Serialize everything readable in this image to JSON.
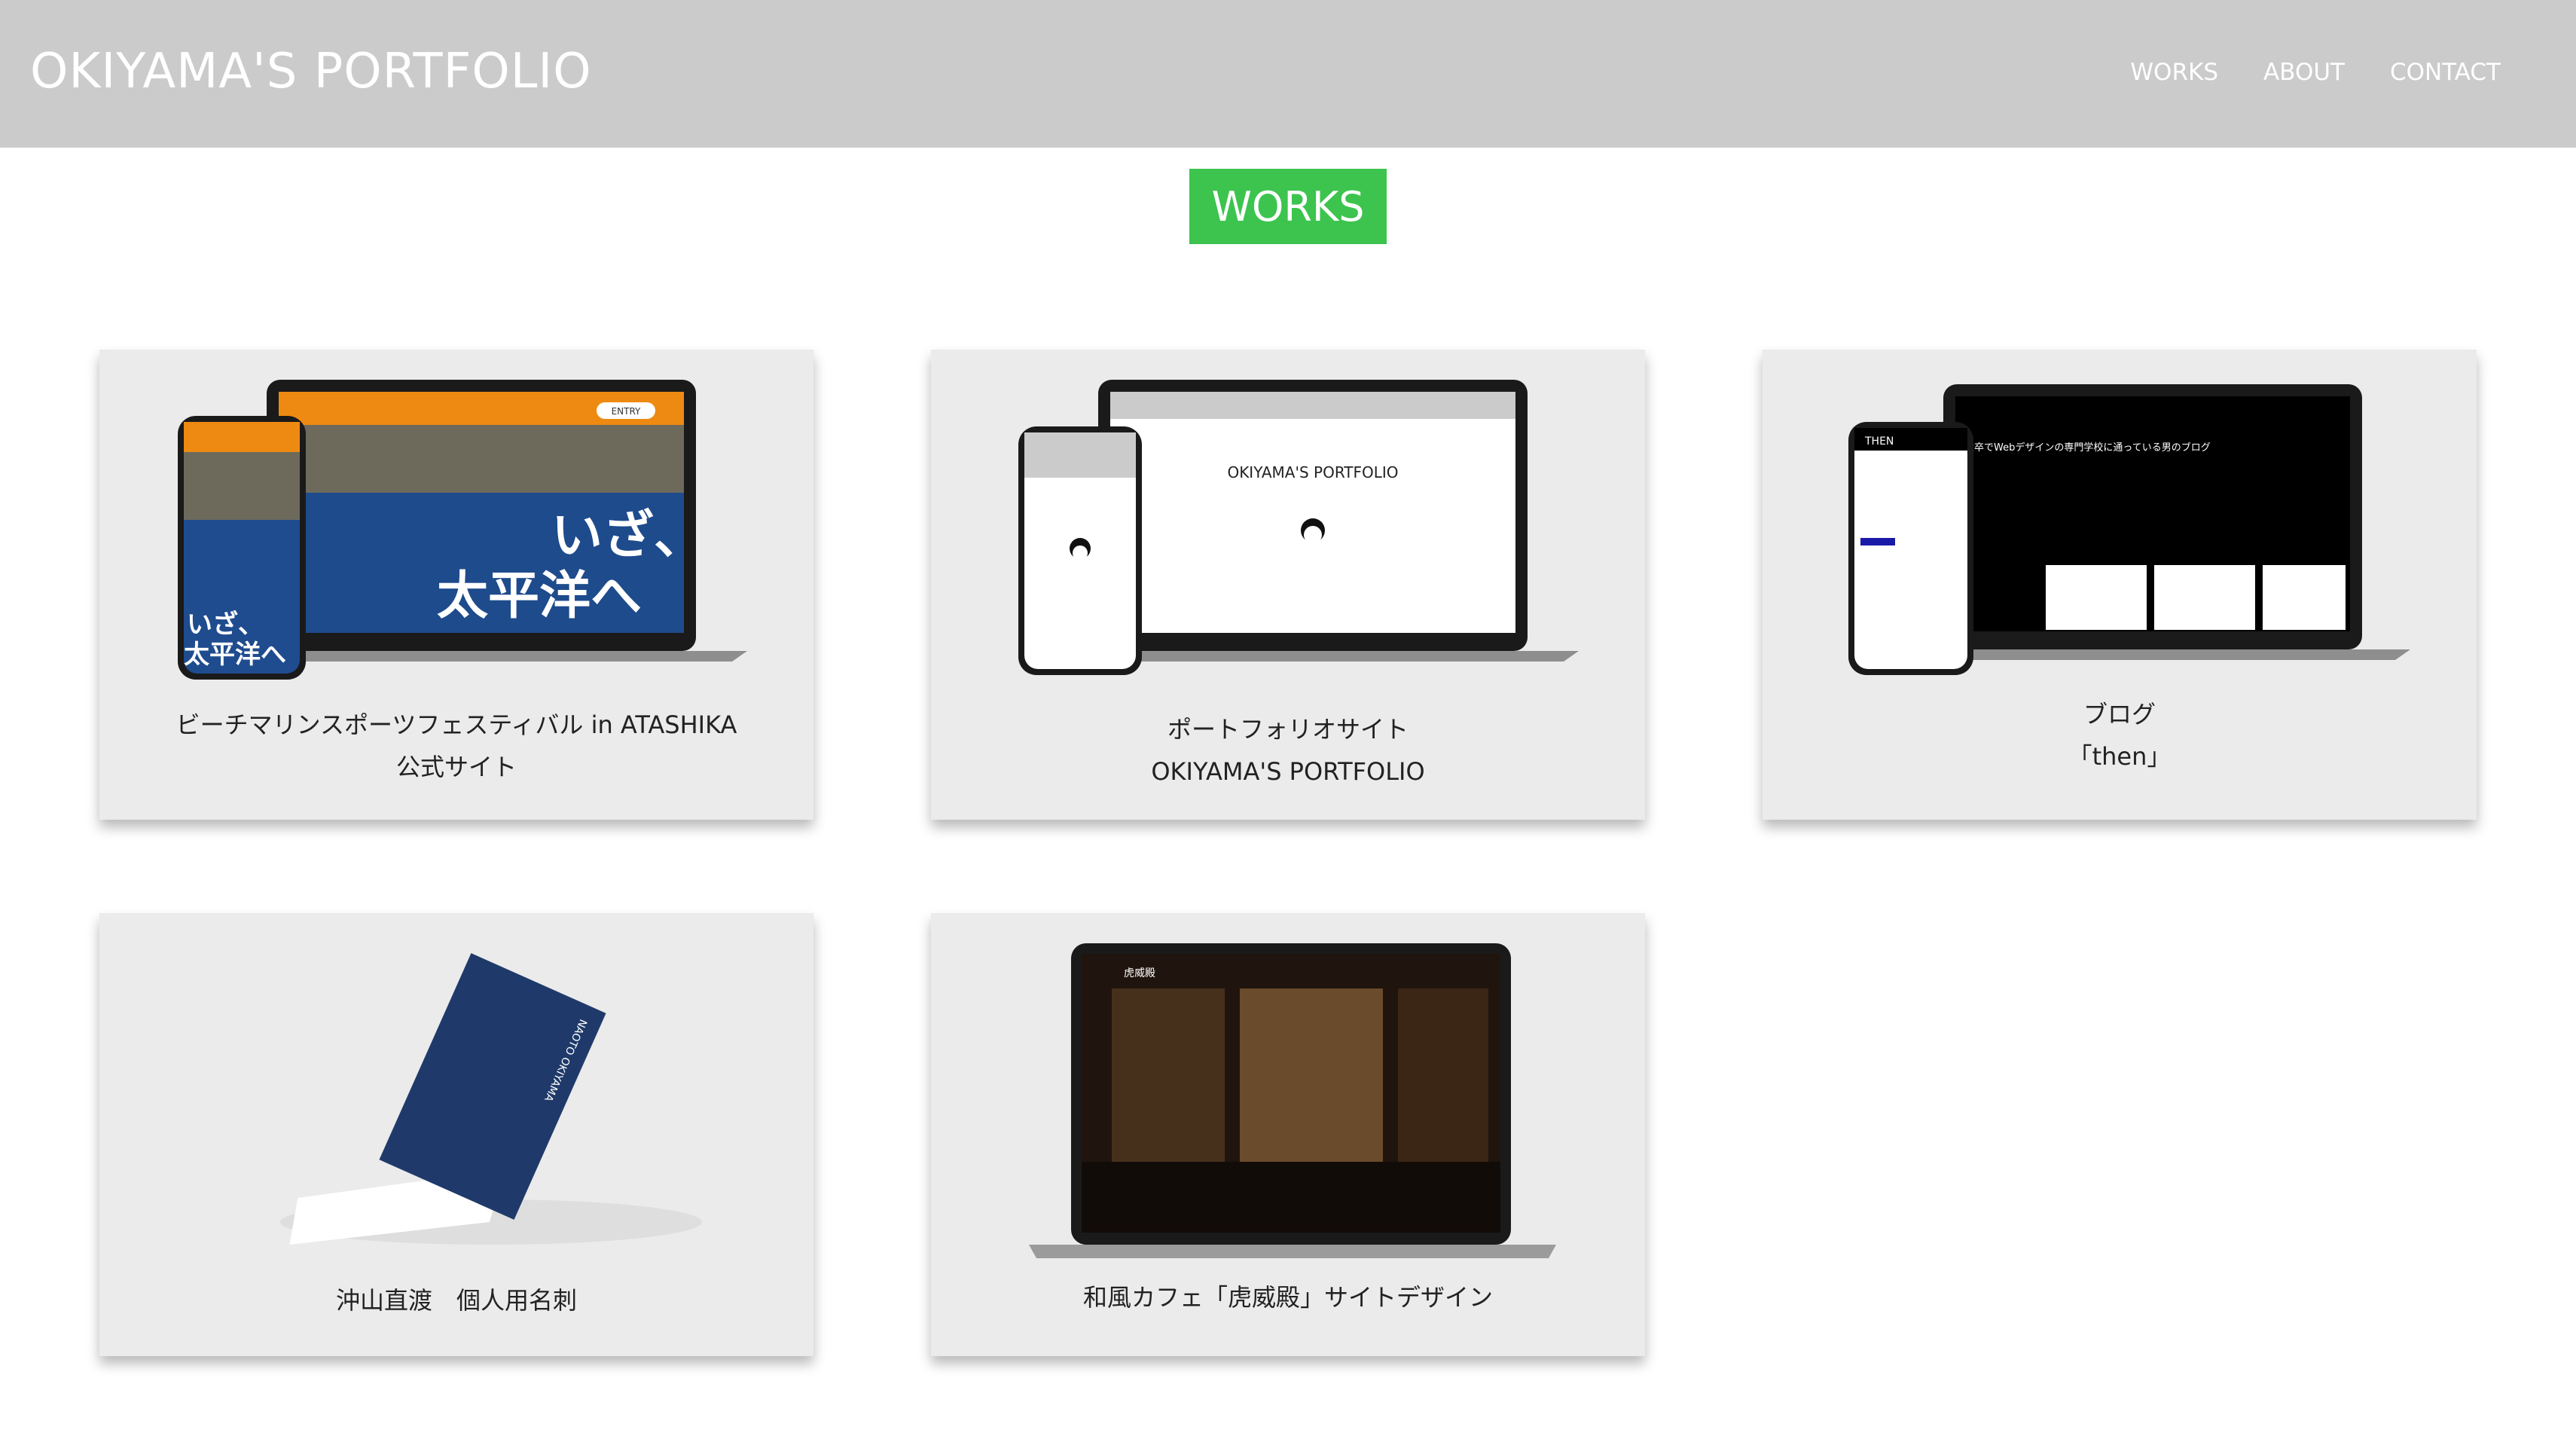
{
  "header": {
    "title": "OKIYAMA'S PORTFOLIO",
    "nav": [
      "WORKS",
      "ABOUT",
      "CONTACT"
    ]
  },
  "section": {
    "badge": "WORKS",
    "badge_color": "#3cc44e"
  },
  "works": [
    {
      "caption_line1": "ビーチマリンスポーツフェスティバル in ATASHIKA",
      "caption_line2": "公式サイト",
      "mock_text_main": "いざ、太平洋へ",
      "mock_text_top": "ENTRY"
    },
    {
      "caption_line1": "ポートフォリオサイト",
      "caption_line2": "OKIYAMA'S PORTFOLIO",
      "mock_text_main": "OKIYAMA'S PORTFOLIO"
    },
    {
      "caption_line1": "ブログ",
      "caption_line2": "「then」",
      "mock_text_main": "大卒でWebデザインの専門学校に通っている男のブログ",
      "mock_text_logo": "THEN"
    },
    {
      "caption_line1": "沖山直渡　個人用名刺",
      "mock_text_main": "NAOTO OKIYAMA"
    },
    {
      "caption_line1": "和風カフェ「虎威殿」サイトデザイン",
      "mock_text_main": "虎威殿"
    }
  ]
}
